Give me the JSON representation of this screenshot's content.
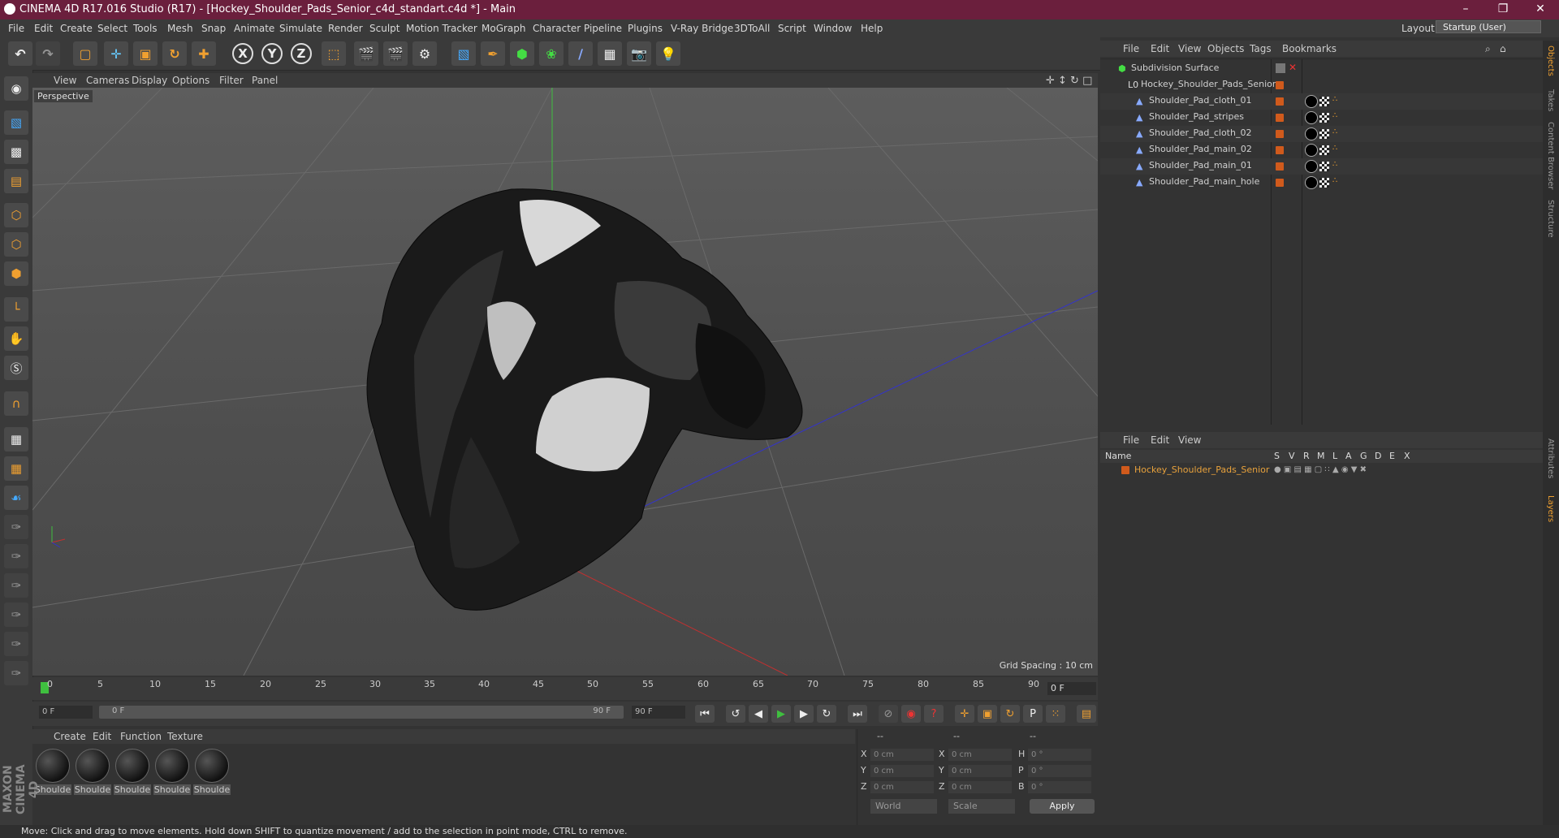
{
  "window": {
    "title": "CINEMA 4D R17.016 Studio (R17) - [Hockey_Shoulder_Pads_Senior_c4d_standart.c4d *] - Main",
    "minimize": "–",
    "maximize": "❐",
    "close": "✕"
  },
  "menubar": {
    "items": [
      "File",
      "Edit",
      "Create",
      "Select",
      "Tools",
      "Mesh",
      "Snap",
      "Animate",
      "Simulate",
      "Render",
      "Sculpt",
      "Motion Tracker",
      "MoGraph",
      "Character",
      "Pipeline",
      "Plugins",
      "V-Ray Bridge",
      "3DToAll",
      "Script",
      "Window",
      "Help"
    ],
    "layout_label": "Layout:",
    "layout_value": "Startup (User)"
  },
  "toolbar": {
    "axis_x": "X",
    "axis_y": "Y",
    "axis_z": "Z"
  },
  "viewport": {
    "menu": [
      "View",
      "Cameras",
      "Display",
      "Options",
      "Filter",
      "Panel"
    ],
    "camera_label": "Perspective",
    "grid_spacing": "Grid Spacing : 10 cm"
  },
  "timeline": {
    "ticks": [
      "0",
      "5",
      "10",
      "15",
      "20",
      "25",
      "30",
      "35",
      "40",
      "45",
      "50",
      "55",
      "60",
      "65",
      "70",
      "75",
      "80",
      "85",
      "90"
    ],
    "current_frame": "0 F",
    "start_frame": "0 F",
    "range_start": "0 F",
    "range_end": "90 F",
    "end_frame": "90 F"
  },
  "materials": {
    "menu": [
      "Create",
      "Edit",
      "Function",
      "Texture"
    ],
    "items": [
      "Shoulde",
      "Shoulde",
      "Shoulde",
      "Shoulde",
      "Shoulde"
    ]
  },
  "coordinates": {
    "header_dashes": [
      "--",
      "--",
      "--"
    ],
    "rows": [
      {
        "axis": "X",
        "pos": "0 cm",
        "axis2": "X",
        "size": "0 cm",
        "rot_label": "H",
        "rot": "0 °"
      },
      {
        "axis": "Y",
        "pos": "0 cm",
        "axis2": "Y",
        "size": "0 cm",
        "rot_label": "P",
        "rot": "0 °"
      },
      {
        "axis": "Z",
        "pos": "0 cm",
        "axis2": "Z",
        "size": "0 cm",
        "rot_label": "B",
        "rot": "0 °"
      }
    ],
    "mode1": "World",
    "mode2": "Scale",
    "apply": "Apply"
  },
  "status": {
    "text": "Move: Click and drag to move elements. Hold down SHIFT to quantize movement / add to the selection in point mode, CTRL to remove."
  },
  "branding": {
    "maxon": "MAXON CINEMA 4D"
  },
  "object_manager": {
    "menu": [
      "File",
      "Edit",
      "View",
      "Objects",
      "Tags",
      "Bookmarks"
    ],
    "objects": [
      {
        "name": "Subdivision Surface",
        "level": 0
      },
      {
        "name": "Hockey_Shoulder_Pads_Senior",
        "level": 1
      },
      {
        "name": "Shoulder_Pad_cloth_01",
        "level": 2
      },
      {
        "name": "Shoulder_Pad_stripes",
        "level": 2
      },
      {
        "name": "Shoulder_Pad_cloth_02",
        "level": 2
      },
      {
        "name": "Shoulder_Pad_main_02",
        "level": 2
      },
      {
        "name": "Shoulder_Pad_main_01",
        "level": 2
      },
      {
        "name": "Shoulder_Pad_main_hole",
        "level": 2
      }
    ]
  },
  "layer_manager": {
    "menu": [
      "File",
      "Edit",
      "View"
    ],
    "columns": [
      "Name",
      "S",
      "V",
      "R",
      "M",
      "L",
      "A",
      "G",
      "D",
      "E",
      "X"
    ],
    "layers": [
      {
        "name": "Hockey_Shoulder_Pads_Senior",
        "color": "#d05a1c"
      }
    ]
  },
  "side_tabs": [
    "Objects",
    "Takes",
    "Content Browser",
    "Structure",
    "Attributes",
    "Layers"
  ],
  "colors": {
    "titlebar": "#6b1f3d",
    "accent_orange": "#d05a1c",
    "layer_text": "#e8a23c"
  }
}
